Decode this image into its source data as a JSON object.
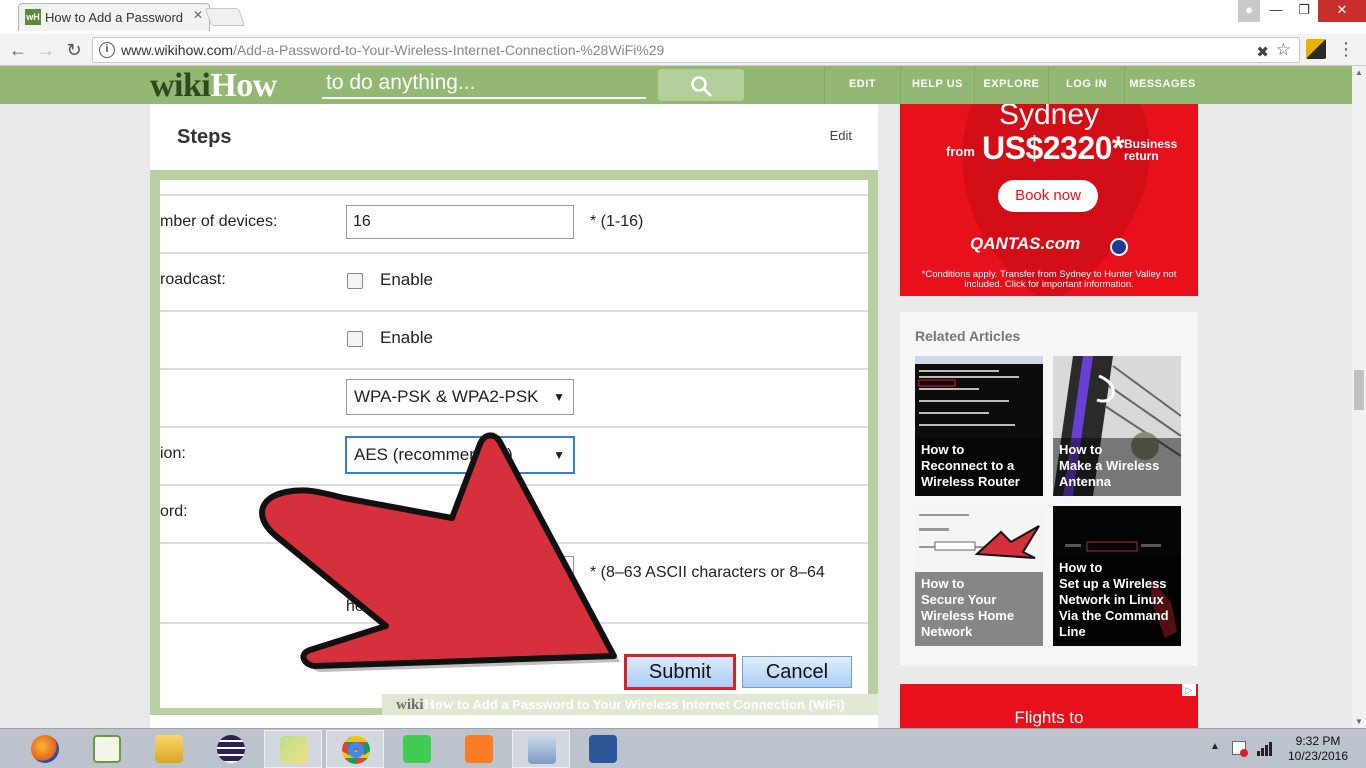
{
  "browser": {
    "tab_title": "How to Add a Password to Your Wireless Internet Connection (WiFi)",
    "tab_favicon": "wH",
    "url_domain": "www.wikihow.com",
    "url_path": "/Add-a-Password-to-Your-Wireless-Internet-Connection-%28WiFi%29"
  },
  "header": {
    "logo_wiki": "wiki",
    "logo_how": "How",
    "search_placeholder": "to do anything...",
    "nav": [
      "EDIT",
      "HELP US",
      "EXPLORE",
      "LOG IN",
      "MESSAGES"
    ]
  },
  "steps": {
    "title": "Steps",
    "edit": "Edit"
  },
  "router_form": {
    "devices_label": "mber of devices:",
    "devices_value": "16",
    "devices_hint": "*   (1-16)",
    "broadcast_label": "roadcast:",
    "enable1": "Enable",
    "enable2": "Enable",
    "security_mode": "WPA-PSK & WPA2-PSK",
    "encryption_label": "ion:",
    "encryption_value": "AES (recommended)",
    "password_label": "ord:",
    "enable3": "Ena",
    "passphrase_hint": "*   (8–63 ASCII characters or 8–64",
    "passphrase_hint2": "he",
    "submit": "Submit",
    "cancel": "Cancel"
  },
  "caption": {
    "wiki": "wiki",
    "how": "How",
    "text": " to Add a Password to Your Wireless Internet Connection (WiFi)"
  },
  "ad_top": {
    "city": "Sydney",
    "from": "from",
    "price": "US$2320",
    "asterisk": "*",
    "fare_line1": "Business",
    "fare_line2": "return",
    "button": "Book now",
    "brand": "QANTAS.com",
    "terms": "*Conditions apply. Transfer from Sydney to Hunter Valley not included. Click for important information."
  },
  "related": {
    "title": "Related Articles",
    "articles": [
      {
        "prefix": "How to",
        "title": "Reconnect to a Wireless Router"
      },
      {
        "prefix": "How to",
        "title": "Make a Wireless Antenna"
      },
      {
        "prefix": "How to",
        "title": "Secure Your Wireless Home Network"
      },
      {
        "prefix": "How to",
        "title": "Set up a Wireless Network in Linux Via the Command Line"
      }
    ]
  },
  "ad_bottom": {
    "text": "Flights to"
  },
  "taskbar": {
    "apps": [
      "firefox-icon",
      "notepad-plus-icon",
      "file-explorer-icon",
      "eclipse-icon",
      "folder-icon",
      "chrome-icon",
      "qt-creator-icon",
      "xampp-icon",
      "network-app-icon",
      "word-icon"
    ],
    "time": "9:32 PM",
    "date": "10/23/2016"
  },
  "colors": {
    "wikihow_green": "#93b874",
    "ad_red": "#e8101a",
    "submit_border": "#d2232a"
  }
}
